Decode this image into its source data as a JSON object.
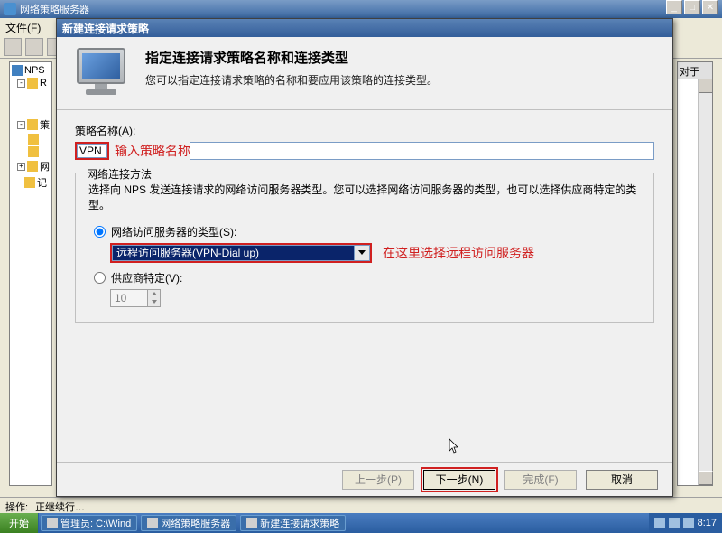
{
  "parent": {
    "title": "网络策略服务器",
    "menu_file": "文件(F)",
    "tree_root": "NPS",
    "tree_r": "R",
    "tree_q": "策",
    "tree_w": "网",
    "tree_z": "记",
    "right_header": "对于",
    "status_label": "操作:",
    "status_value": "正继续行…"
  },
  "taskbar": {
    "start": "开始",
    "tasks": [
      "管理员: C:\\Wind",
      "网络策略服务器",
      "新建连接请求策略"
    ],
    "time": "8:17"
  },
  "dialog": {
    "title": "新建连接请求策略",
    "header_title": "指定连接请求策略名称和连接类型",
    "header_desc": "您可以指定连接请求策略的名称和要应用该策略的连接类型。",
    "policy_name_label": "策略名称(A):",
    "policy_name_value": "VPN",
    "annot_name": "输入策略名称",
    "group_title": "网络连接方法",
    "group_desc": "选择向 NPS 发送连接请求的网络访问服务器类型。您可以选择网络访问服务器的类型，也可以选择供应商特定的类型。",
    "radio_server_type": "网络访问服务器的类型(S):",
    "combo_value": "远程访问服务器(VPN-Dial up)",
    "annot_combo": "在这里选择远程访问服务器",
    "radio_vendor": "供应商特定(V):",
    "vendor_value": "10",
    "btn_prev": "上一步(P)",
    "btn_next": "下一步(N)",
    "btn_finish": "完成(F)",
    "btn_cancel": "取消"
  }
}
